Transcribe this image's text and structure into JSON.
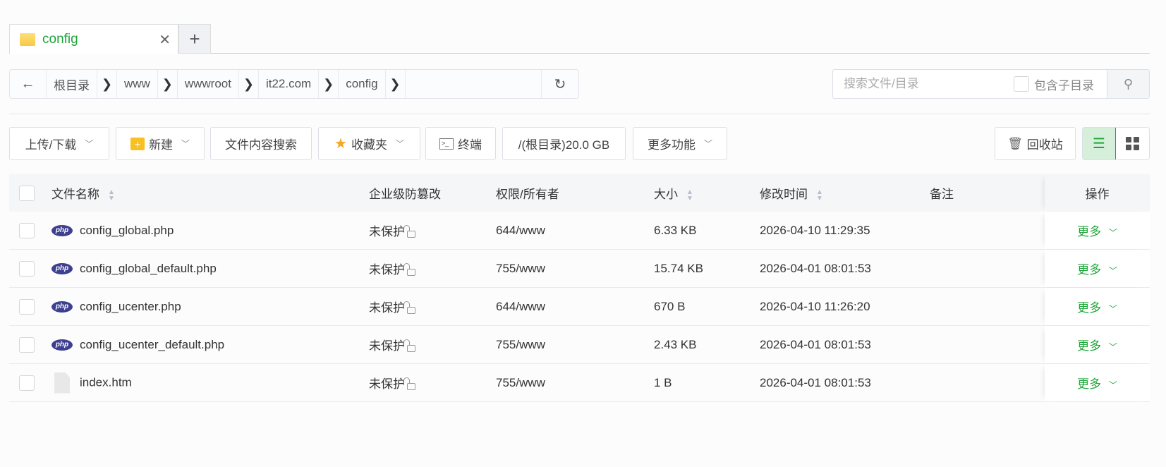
{
  "tab": {
    "label": "config",
    "close": "✕",
    "add": "+"
  },
  "breadcrumb": {
    "back": "←",
    "segments": [
      "根目录",
      "www",
      "wwwroot",
      "it22.com",
      "config"
    ],
    "sep": "❯",
    "refresh": "↻"
  },
  "search": {
    "placeholder": "搜索文件/目录",
    "include_sub": "包含子目录",
    "icon": "search-icon"
  },
  "toolbar": {
    "upload": "上传/下载",
    "new": "新建",
    "content_search": "文件内容搜索",
    "favorites": "收藏夹",
    "terminal": "终端",
    "disk": "/(根目录)20.0 GB",
    "more": "更多功能",
    "recycle": "回收站",
    "chev": "﹀"
  },
  "table": {
    "headers": {
      "name": "文件名称",
      "protect": "企业级防篡改",
      "perm": "权限/所有者",
      "size": "大小",
      "mtime": "修改时间",
      "note": "备注",
      "ops": "操作"
    },
    "rows": [
      {
        "name": "config_global.php",
        "type": "php",
        "protect": "未保护",
        "perm": "644/www",
        "size": "6.33 KB",
        "mtime": "2026-04-10 11:29:35",
        "op": "更多"
      },
      {
        "name": "config_global_default.php",
        "type": "php",
        "protect": "未保护",
        "perm": "755/www",
        "size": "15.74 KB",
        "mtime": "2026-04-01 08:01:53",
        "op": "更多"
      },
      {
        "name": "config_ucenter.php",
        "type": "php",
        "protect": "未保护",
        "perm": "644/www",
        "size": "670 B",
        "mtime": "2026-04-10 11:26:20",
        "op": "更多"
      },
      {
        "name": "config_ucenter_default.php",
        "type": "php",
        "protect": "未保护",
        "perm": "755/www",
        "size": "2.43 KB",
        "mtime": "2026-04-01 08:01:53",
        "op": "更多"
      },
      {
        "name": "index.htm",
        "type": "doc",
        "protect": "未保护",
        "perm": "755/www",
        "size": "1 B",
        "mtime": "2026-04-01 08:01:53",
        "op": "更多"
      }
    ]
  },
  "colors": {
    "accent": "#20a53a"
  }
}
